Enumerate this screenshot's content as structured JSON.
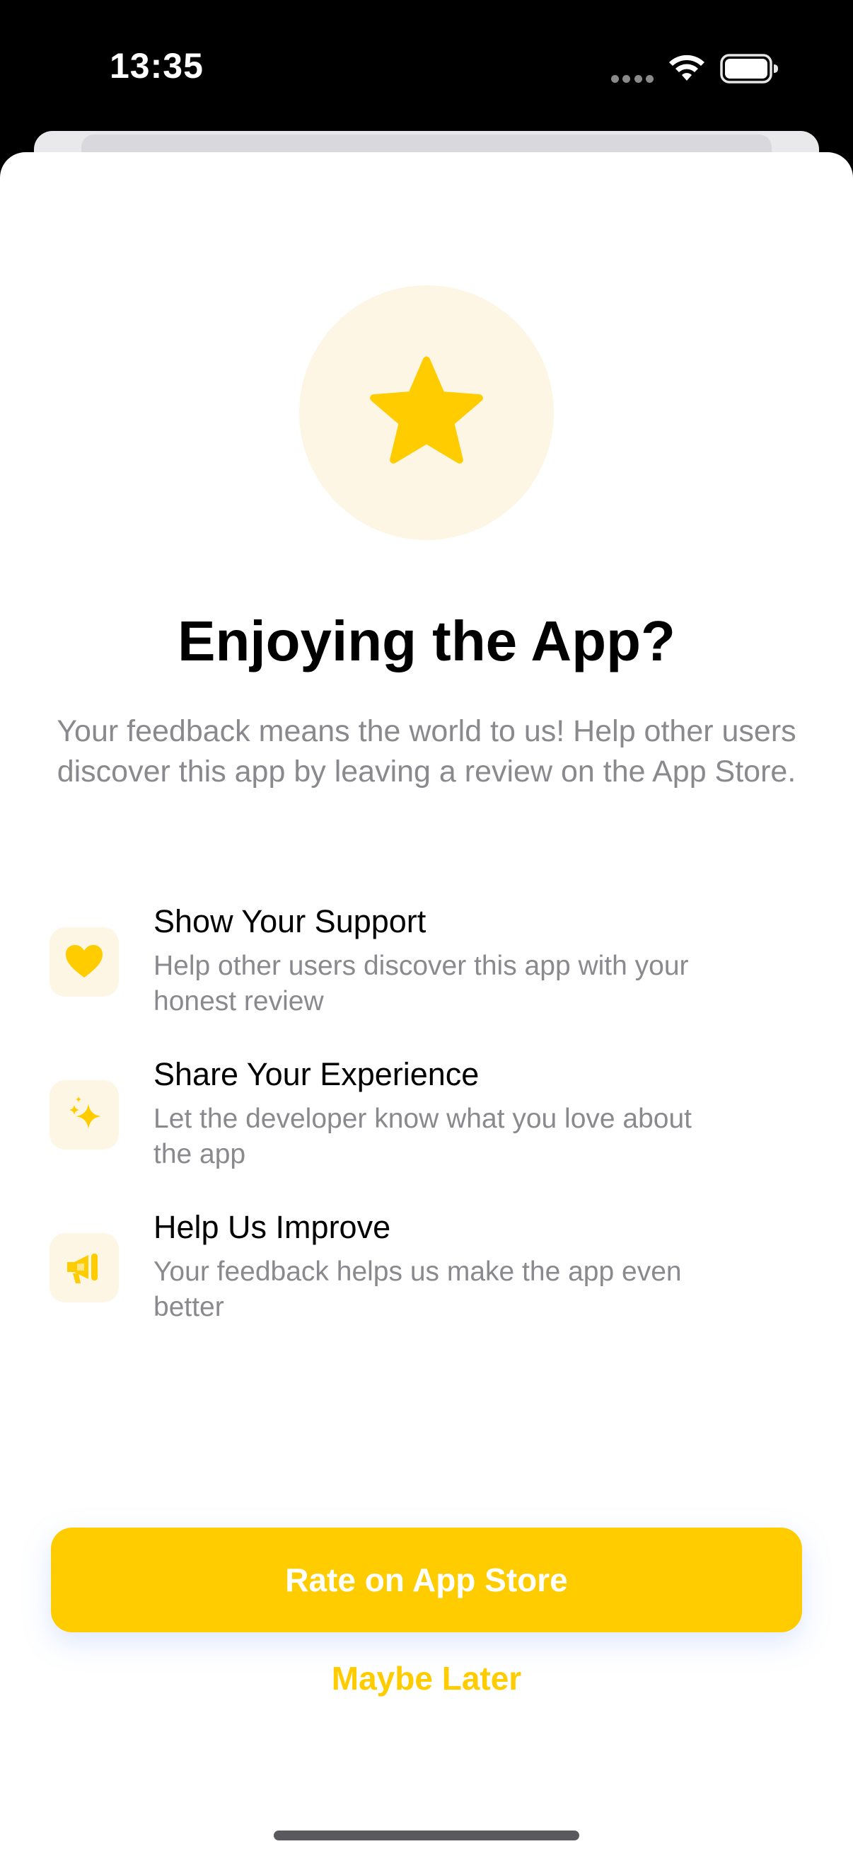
{
  "status_bar": {
    "time": "13:35"
  },
  "hero": {
    "icon": "star-icon",
    "title": "Enjoying the App?",
    "subtitle": "Your feedback means the world to us! Help other users discover this app by leaving a review on the App Store."
  },
  "features": [
    {
      "icon": "heart-icon",
      "title": "Show Your Support",
      "description": "Help other users discover this app with your honest review"
    },
    {
      "icon": "sparkles-icon",
      "title": "Share Your Experience",
      "description": "Let the developer know what you love about the app"
    },
    {
      "icon": "megaphone-icon",
      "title": "Help Us Improve",
      "description": "Your feedback helps us make the app even better"
    }
  ],
  "actions": {
    "rate_label": "Rate on App Store",
    "later_label": "Maybe Later"
  },
  "colors": {
    "accent": "#ffcc00",
    "icon_background": "#fdf6e4",
    "secondary_text": "#8a8a8e"
  }
}
